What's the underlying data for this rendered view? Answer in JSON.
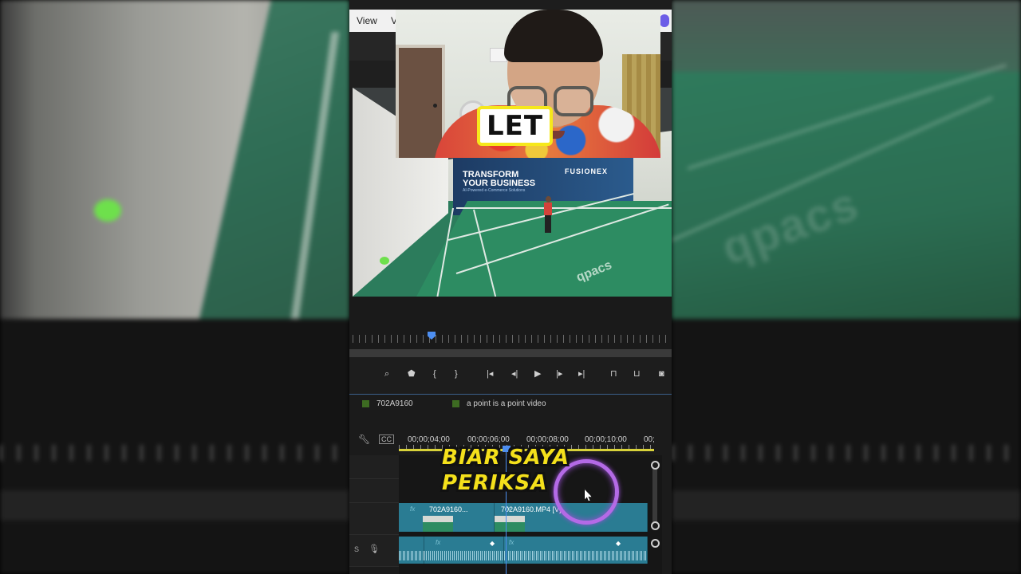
{
  "menubar": {
    "items": [
      "View",
      "V"
    ]
  },
  "preview": {
    "banner_title": "TRANSFORM\nYOUR BUSINESS",
    "banner_sub": "AI-Powered e-Commerce Solutions",
    "banner_brand": "FUSIONEX",
    "court_brand": "qpacs",
    "caption": "LET"
  },
  "timeline": {
    "tabs": [
      {
        "label": "702A9160",
        "color": "#3d6b22"
      },
      {
        "label": "a point is a point video",
        "color": "#3d6b22"
      }
    ],
    "ruler": [
      "00;00;04;00",
      "00;00;06;00",
      "00;00;08;00",
      "00;00;10;00",
      "00;"
    ],
    "clips": [
      {
        "name": "702A9160...",
        "fx": "fx"
      },
      {
        "name": "702A9160.MP4 [V]",
        "fx": "fx"
      }
    ],
    "audio_track_label": "S",
    "caption_line1": "BIAR SAYA",
    "caption_line2": "PERIKSA"
  },
  "icons": {
    "wrench": "wrench-icon",
    "cc": "closed-caption-icon",
    "mic": "microphone-icon"
  },
  "colors": {
    "playhead": "#4d8ef0",
    "clip": "#2a7c93",
    "caption_yellow": "#f4e01b",
    "ring": "#b46ae6"
  }
}
